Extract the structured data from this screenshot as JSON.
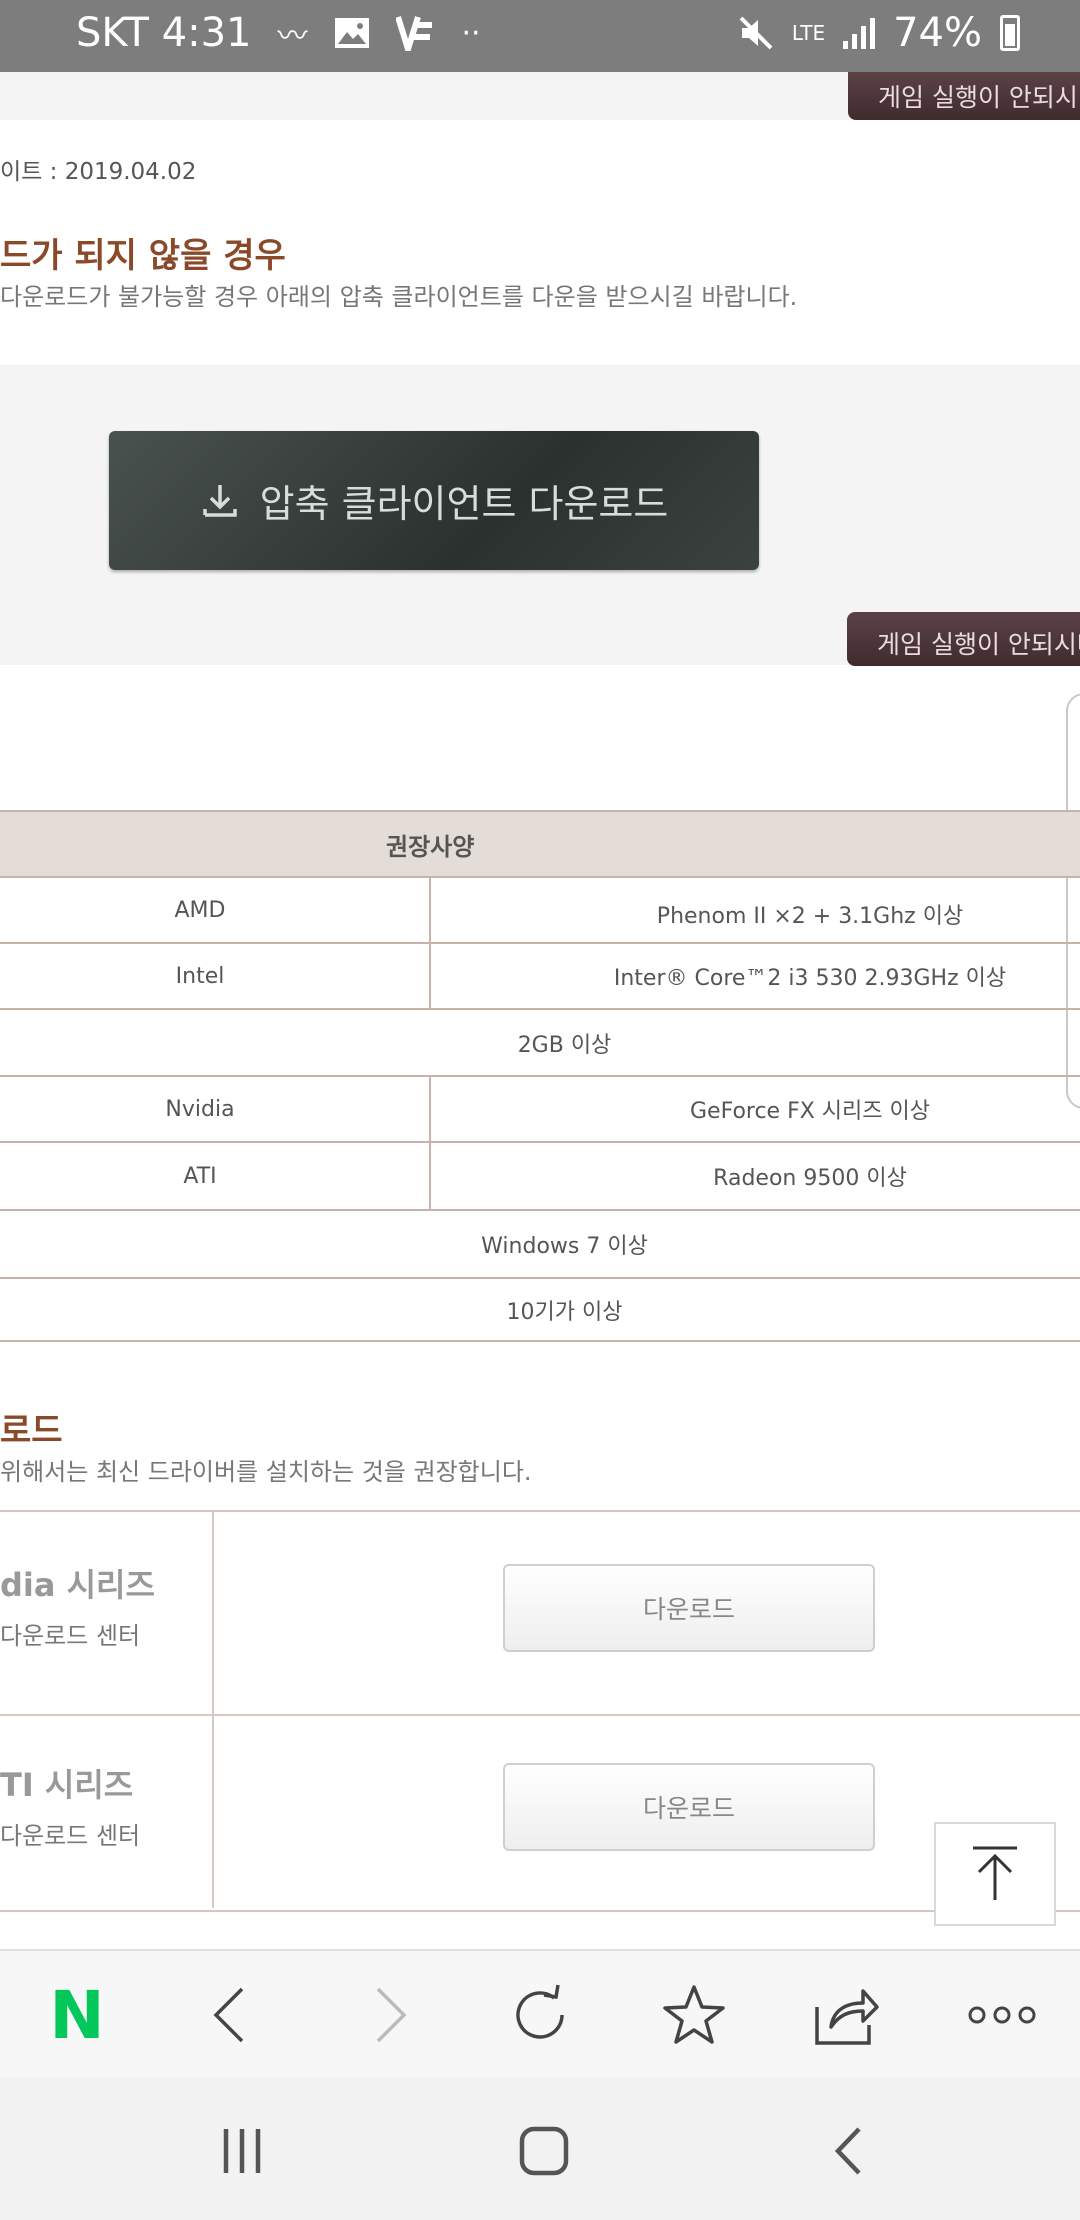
{
  "status_bar": {
    "carrier": "SKT",
    "time": "4:31",
    "network": "LTE",
    "battery": "74%"
  },
  "tabs": {
    "game_not_running": "게임 실행이 안되시나"
  },
  "page": {
    "update_date": "이트 : 2019.04.02",
    "download_fail_title": "드가 되지 않을 경우",
    "download_fail_desc": "다운로드가 불가능할 경우 아래의 압축 클라이언트를 다운을 받으시길 바랍니다.",
    "zip_download_label": "압축 클라이언트 다운로드"
  },
  "spec_table": {
    "header": "권장사양",
    "rows": [
      {
        "label": "AMD",
        "value": "Phenom II ×2 + 3.1Ghz 이상"
      },
      {
        "label": "Intel",
        "value": "Inter® Core™2  i3 530 2.93GHz 이상"
      },
      {
        "value": "2GB 이상"
      },
      {
        "label": "Nvidia",
        "value": "GeForce FX 시리즈 이상"
      },
      {
        "label": "ATI",
        "value": "Radeon 9500 이상"
      },
      {
        "value": "Windows 7 이상"
      },
      {
        "value": "10기가 이상"
      }
    ]
  },
  "driver_section": {
    "title": "로드",
    "desc": "위해서는 최신 드라이버를 설치하는 것을 권장합니다.",
    "items": [
      {
        "name": "dia 시리즈",
        "sub": "다운로드 센터",
        "button": "다운로드"
      },
      {
        "name": "TI 시리즈",
        "sub": "다운로드 센터",
        "button": "다운로드"
      }
    ]
  },
  "browser": {
    "logo": "N"
  },
  "colors": {
    "accent_brown": "#8a4a2a",
    "naver_green": "#03c75a",
    "table_border": "#c7b3ab"
  }
}
